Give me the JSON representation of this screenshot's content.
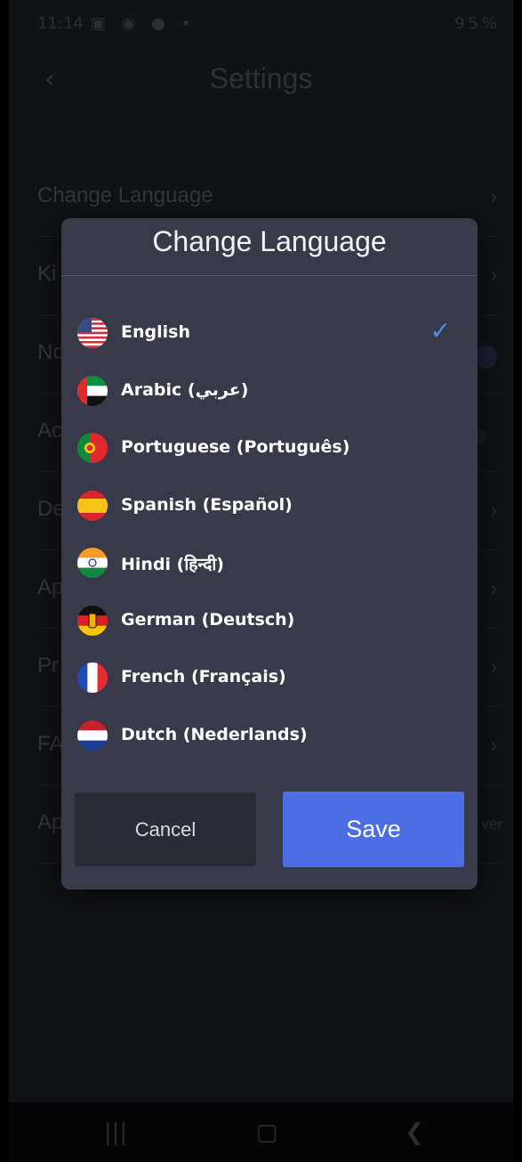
{
  "status_bar": {
    "time": "11:14",
    "left_icons": "▣ ◉ ● •",
    "battery": "95%"
  },
  "header": {
    "title": "Settings",
    "back_icon": "chevron-left-icon"
  },
  "settings": [
    {
      "label": "Change Language",
      "control": "chevron"
    },
    {
      "label": "Ki",
      "control": "chevron"
    },
    {
      "label": "No",
      "control": "toggle-on"
    },
    {
      "label": "Ac",
      "control": "toggle-off"
    },
    {
      "label": "De",
      "control": "chevron"
    },
    {
      "label": "Ap",
      "control": "chevron"
    },
    {
      "label": "Pr",
      "control": "chevron"
    },
    {
      "label": "FA",
      "control": "chevron"
    },
    {
      "label": "Ap",
      "control": "value",
      "value": "ver"
    }
  ],
  "dialog": {
    "title": "Change Language",
    "languages": [
      {
        "label": "English",
        "flag": "us-flag-icon",
        "selected": true
      },
      {
        "label": "Arabic (عربي)",
        "flag": "uae-flag-icon",
        "selected": false
      },
      {
        "label": "Portuguese (Português)",
        "flag": "portugal-flag-icon",
        "selected": false
      },
      {
        "label": "Spanish (Español)",
        "flag": "spain-flag-icon",
        "selected": false
      },
      {
        "label": "Hindi (हिन्दी)",
        "flag": "india-flag-icon",
        "selected": false
      },
      {
        "label": "German (Deutsch)",
        "flag": "germany-flag-icon",
        "selected": false
      },
      {
        "label": "French (Français)",
        "flag": "france-flag-icon",
        "selected": false
      },
      {
        "label": "Dutch (Nederlands)",
        "flag": "netherlands-flag-icon",
        "selected": false
      }
    ],
    "cancel_label": "Cancel",
    "save_label": "Save"
  },
  "colors": {
    "accent": "#4c6ee2",
    "check": "#4a90f0",
    "dialog_bg": "#393a49"
  }
}
